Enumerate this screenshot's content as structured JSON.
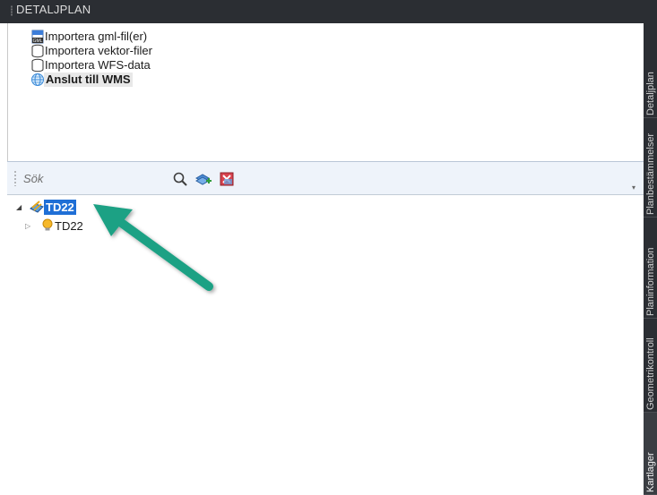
{
  "panel": {
    "title": "DETALJPLAN"
  },
  "actions": [
    {
      "label": "Importera gml-fil(er)",
      "icon": "gml-file-icon"
    },
    {
      "label": "Importera vektor-filer",
      "icon": "database-icon"
    },
    {
      "label": "Importera WFS-data",
      "icon": "database-icon"
    },
    {
      "label": "Anslut till WMS",
      "icon": "globe-icon"
    }
  ],
  "search": {
    "placeholder": "Sök"
  },
  "toolbar": {
    "icons": [
      "search-icon",
      "add-layer-icon",
      "remove-layer-icon"
    ]
  },
  "tree": {
    "root": {
      "label": "TD22",
      "expanded": true,
      "selected": true
    },
    "child": {
      "label": "TD22",
      "expanded": false
    }
  },
  "side_tabs": [
    "Detaljplan",
    "Planbestämmelser",
    "Planinformation",
    "Geometrikontroll",
    "Kartlager"
  ],
  "colors": {
    "selection": "#1f6fd6",
    "arrow": "#1ea184",
    "dark_chrome": "#2b2e33"
  }
}
